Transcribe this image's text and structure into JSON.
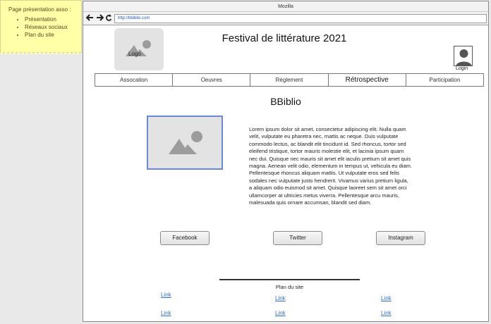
{
  "note": {
    "title": "Page présentation asso :",
    "items": [
      "Présentation",
      "Réseaux sociaux",
      "Plan du site"
    ]
  },
  "browser": {
    "title": "Mozilla",
    "url": "http://bbiblio.com",
    "icons": [
      "back-arrow-icon",
      "forward-arrow-icon",
      "reload-icon"
    ]
  },
  "header": {
    "logo_label": "Logo",
    "site_title": "Festival de littérature 2021",
    "login_label": "Login"
  },
  "tabs": [
    {
      "label": "Assocation",
      "active": false
    },
    {
      "label": "Oeuvres",
      "active": false
    },
    {
      "label": "Règlement",
      "active": false
    },
    {
      "label": "Rétrospective",
      "active": true
    },
    {
      "label": "Participation",
      "active": false
    }
  ],
  "main": {
    "heading": "BBiblio",
    "body": "Lorem ipsum dolor sit amet, consectetur adipiscing elit. Nulla quam velit, vulputate eu pharetra nec, mattis ac neque. Duis vulputate commodo lectus, ac blandit elit tincidunt id. Sed rhoncus, tortor sed eleifend tristique, tortor mauris molestie elit, et lacinia ipsum quam nec dui. Quisque nec mauris sit amet elit iaculis pretium sit amet quis magna. Aenean velit odio, elementum in tempus ut, vehicula eu diam. Pellentesque rhoncus aliquam mattis. Ut vulputate eros sed felis sodales nec vulputate justo hendrerit. Vivamus varius pretium ligula, a aliquam odio euismod sit amet. Quisque laoreet sem sit amet orci ullamcorper at ultricies metus viverra. Pellentesque arcu mauris, malesuada quis ornare accumsan, blandit sed diam."
  },
  "social": {
    "facebook": "Facebook",
    "twitter": "Twitter",
    "instagram": "Instagram"
  },
  "footer": {
    "sitemap_title": "Plan du site",
    "links": [
      "Link",
      "Link",
      "Link",
      "Link",
      "Link",
      "Link"
    ]
  },
  "colors": {
    "note_bg": "#ffffa8",
    "link": "#2f6fd8",
    "image_border": "#6b87d8"
  }
}
